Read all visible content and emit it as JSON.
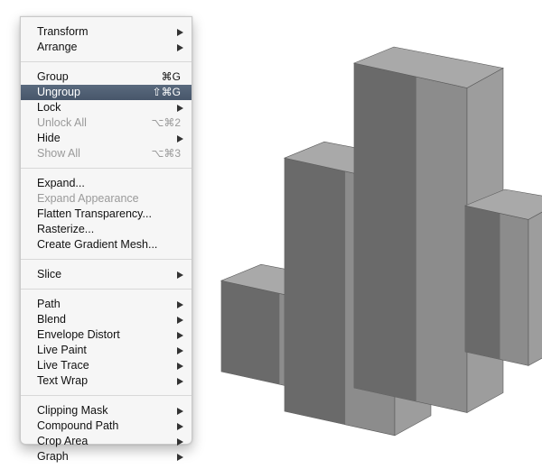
{
  "menu": {
    "groups": [
      [
        {
          "label": "Transform",
          "submenu": true
        },
        {
          "label": "Arrange",
          "submenu": true
        }
      ],
      [
        {
          "label": "Group",
          "shortcut": "⌘G"
        },
        {
          "label": "Ungroup",
          "shortcut": "⇧⌘G",
          "selected": true
        },
        {
          "label": "Lock",
          "submenu": true
        },
        {
          "label": "Unlock All",
          "shortcut": "⌥⌘2",
          "disabled": true
        },
        {
          "label": "Hide",
          "submenu": true
        },
        {
          "label": "Show All",
          "shortcut": "⌥⌘3",
          "disabled": true
        }
      ],
      [
        {
          "label": "Expand..."
        },
        {
          "label": "Expand Appearance",
          "disabled": true
        },
        {
          "label": "Flatten Transparency..."
        },
        {
          "label": "Rasterize..."
        },
        {
          "label": "Create Gradient Mesh..."
        }
      ],
      [
        {
          "label": "Slice",
          "submenu": true
        }
      ],
      [
        {
          "label": "Path",
          "submenu": true
        },
        {
          "label": "Blend",
          "submenu": true
        },
        {
          "label": "Envelope Distort",
          "submenu": true
        },
        {
          "label": "Live Paint",
          "submenu": true
        },
        {
          "label": "Live Trace",
          "submenu": true
        },
        {
          "label": "Text Wrap",
          "submenu": true
        }
      ],
      [
        {
          "label": "Clipping Mask",
          "submenu": true
        },
        {
          "label": "Compound Path",
          "submenu": true
        },
        {
          "label": "Crop Area",
          "submenu": true
        },
        {
          "label": "Graph",
          "submenu": true
        }
      ]
    ]
  },
  "graph_art": {
    "type": "3d-bar",
    "bar_count": 4,
    "values": [
      0.28,
      0.78,
      1.0,
      0.45
    ],
    "colors": {
      "top": "#a9a9a9",
      "front": "#8c8c8c",
      "side": "#6a6a6a",
      "edge": "#5a5a5a"
    }
  }
}
